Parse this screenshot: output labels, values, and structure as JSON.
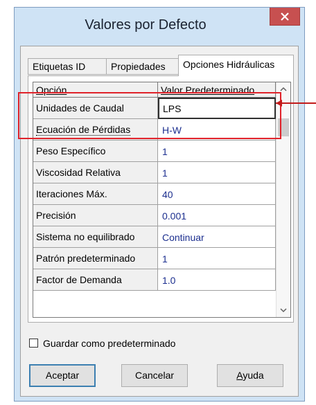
{
  "window": {
    "title": "Valores por Defecto"
  },
  "tabs": [
    {
      "label": "Etiquetas ID",
      "active": false
    },
    {
      "label": "Propiedades",
      "active": false
    },
    {
      "label": "Opciones Hidráulicas",
      "active": true
    }
  ],
  "grid": {
    "headers": [
      "Opción",
      "Valor Predeterminado"
    ],
    "rows": [
      {
        "option": "Unidades de Caudal",
        "value": "LPS"
      },
      {
        "option": "Ecuación de Pérdidas",
        "value": "H-W"
      },
      {
        "option": "Peso Específico",
        "value": "1"
      },
      {
        "option": "Viscosidad Relativa",
        "value": "1"
      },
      {
        "option": "Iteraciones Máx.",
        "value": "40"
      },
      {
        "option": "Precisión",
        "value": "0.001"
      },
      {
        "option": "Sistema no equilibrado",
        "value": "Continuar"
      },
      {
        "option": "Patrón predeterminado",
        "value": "1"
      },
      {
        "option": "Factor de Demanda",
        "value": "1.0"
      }
    ]
  },
  "checkbox": {
    "label": "Guardar como predeterminado",
    "checked": false
  },
  "buttons": {
    "ok": "Aceptar",
    "cancel": "Cancelar",
    "help_prefix": "",
    "help_underlined": "A",
    "help_rest": "yuda"
  },
  "colors": {
    "titlebar": "#cfe3f5",
    "close": "#c75050",
    "value_text": "#1c2f8f",
    "annotation": "#e0222a"
  }
}
